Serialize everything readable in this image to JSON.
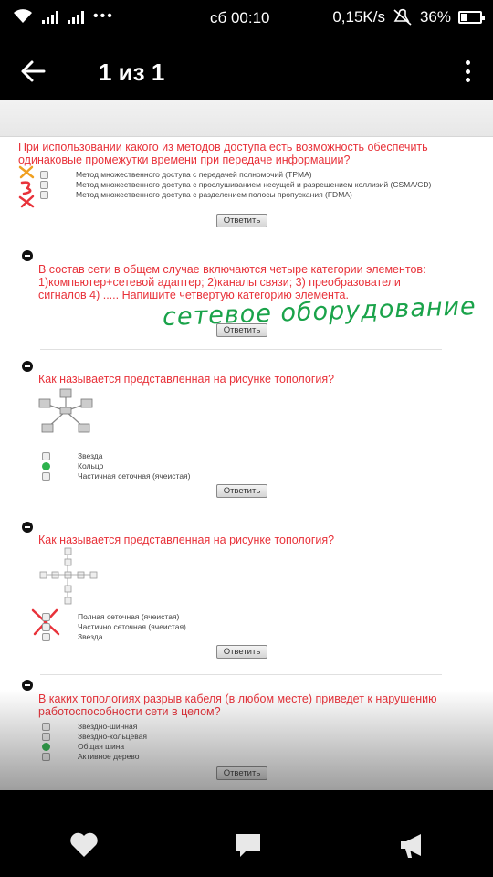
{
  "status_bar": {
    "time": "сб 00:10",
    "speed": "0,15K/s",
    "battery": "36%",
    "battery_level": 0.36,
    "dots": "•••"
  },
  "app_bar": {
    "back_icon": "arrow-left-icon",
    "title": "1 из 1",
    "more_icon": "more-vertical-icon"
  },
  "photo": {
    "answer_label": "Ответить",
    "questions": [
      {
        "text": "При использовании какого из методов доступа есть возможность обеспечить одинаковые промежутки времени при передаче информации?",
        "options": [
          "Метод множественного доступа с передачей полномочий (TPMA)",
          "Метод множественного доступа с прослушиванием несущей и разрешением коллизий (CSMA/CD)",
          "Метод множественного доступа с разделением полосы пропускания (FDMA)"
        ]
      },
      {
        "text": "В состав сети в общем случае включаются четыре категории элементов: 1)компьютер+сетевой адаптер; 2)каналы связи; 3) преобразователи сигналов 4) ..... Напишите четвертую категорию элемента.",
        "handwriting": "сетевое оборудование"
      },
      {
        "text": "Как называется представленная на рисунке топология?",
        "options": [
          "Звезда",
          "Кольцо",
          "Частичная сеточная (ячеистая)"
        ]
      },
      {
        "text": "Как называется представленная на рисунке топология?",
        "options": [
          "Полная сеточная (ячеистая)",
          "Частично сеточная (ячеистая)",
          "Звезда"
        ]
      },
      {
        "text": "В каких топологиях разрыв кабеля (в любом месте) приведет к нарушению работоспособности сети в целом?",
        "options": [
          "Звездно-шинная",
          "Звездно-кольцевая",
          "Общая шина",
          "Активное дерево"
        ]
      }
    ],
    "colors": {
      "question_red": "#e8323a",
      "handwriting_green": "#1aa34a",
      "mark_red": "#e8323a",
      "mark_orange": "#f0a020"
    }
  },
  "bottom_bar": {
    "like_icon": "heart-icon",
    "comment_icon": "comment-icon",
    "share_icon": "megaphone-icon"
  }
}
